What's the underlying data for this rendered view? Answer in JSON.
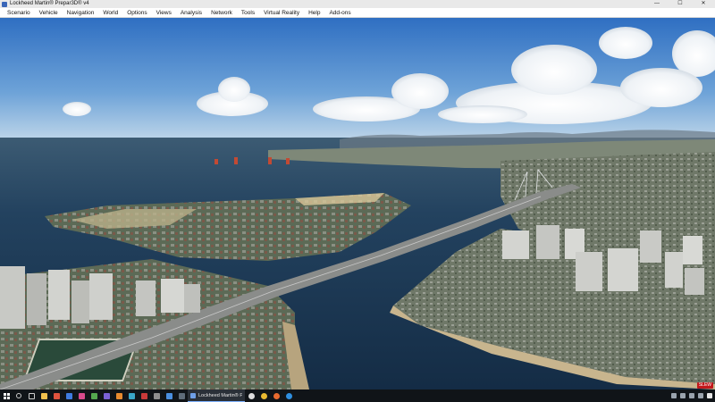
{
  "window": {
    "title": "Lockheed Martin® Prepar3D® v4",
    "controls": {
      "minimize": "—",
      "maximize": "☐",
      "close": "✕"
    }
  },
  "menu": {
    "items": [
      "Scenario",
      "Vehicle",
      "Navigation",
      "World",
      "Options",
      "Views",
      "Analysis",
      "Network",
      "Tools",
      "Virtual Reality",
      "Help",
      "Add-ons"
    ]
  },
  "taskbar": {
    "active_app_label": "Lockheed Martin® Pr...",
    "badge": "SLEW",
    "pinned_icons": [
      "start-icon",
      "search-icon",
      "task-view-icon",
      "app-icon-1",
      "app-icon-2",
      "app-icon-3",
      "app-icon-4",
      "app-icon-5",
      "app-icon-6",
      "app-icon-7",
      "app-icon-8",
      "app-icon-9",
      "app-icon-10",
      "app-icon-11",
      "app-icon-12"
    ],
    "after_icons": [
      "app-icon-13",
      "chrome-icon",
      "firefox-icon",
      "edge-icon"
    ],
    "tray_icons": [
      "chevron-up-icon",
      "network-icon",
      "volume-icon",
      "keyboard-icon",
      "notification-icon"
    ]
  },
  "scene": {
    "sky_top": "#3b78c6",
    "sky_horizon": "#b9d3ea",
    "water": "#1c3a55",
    "land": "#6b7460"
  }
}
